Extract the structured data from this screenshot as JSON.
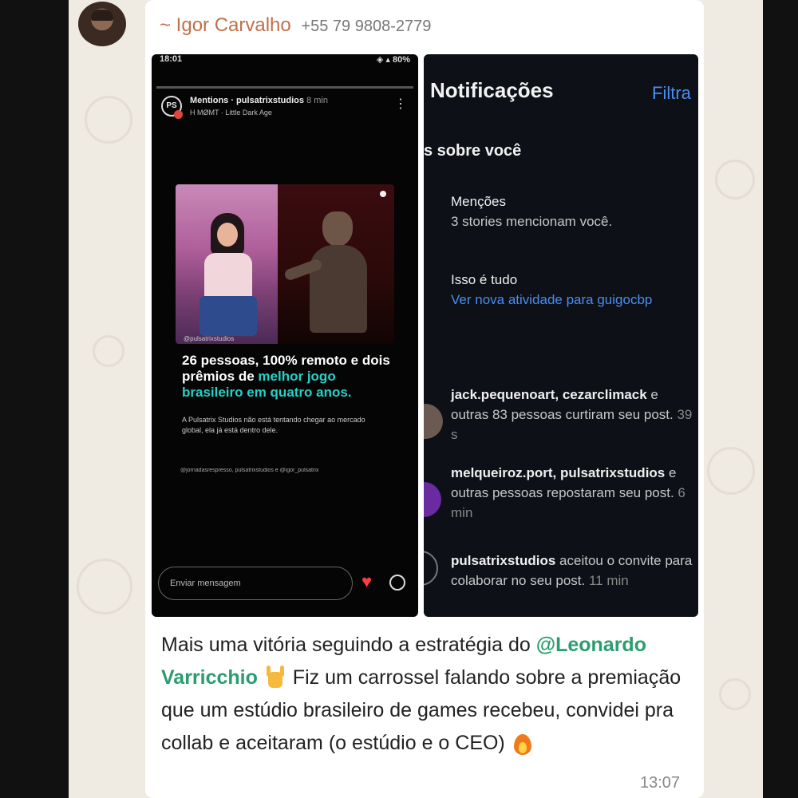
{
  "message": {
    "sender_name": "~ Igor Carvalho",
    "sender_phone": "+55 79 9808-2779",
    "time": "13:07",
    "text_before_mention": "Mais uma vitória seguindo a estratégia do ",
    "mention": "@Leonardo Varricchio",
    "text_after_mention": " Fiz um carrossel falando sobre a premiação que um estúdio brasileiro de games recebeu, convidei pra collab e aceitaram (o estúdio e o CEO)"
  },
  "story": {
    "status_time": "18:01",
    "status_icons": "◈ ▴ 80%",
    "logo": "PS",
    "title": "Mentions · pulsatrixstudios",
    "ago": "8 min",
    "music": "H MØMT · Little Dark Age",
    "photo_tag": "@pulsatrixstudios",
    "headline_plain": "26 pessoas, 100% remoto e dois prêmios de ",
    "headline_highlight": "melhor jogo brasileiro em quatro anos.",
    "subtext": "A Pulsatrix Studios não está tentando chegar ao mercado global, ela já está dentro dele.",
    "mentions_line": "@jornadasrespresso, pulsatrixstudios e @igor_pulsatrix",
    "input_placeholder": "Enviar mensagem",
    "colors": {
      "highlight": "#26d0c6",
      "heart": "#ff3b4a"
    }
  },
  "notifications": {
    "title": "Notificações",
    "filter": "Filtra",
    "section": "s sobre você",
    "items": [
      {
        "strong": "Menções",
        "text": "3 stories mencionam você.",
        "time": ""
      },
      {
        "strong": "Isso é tudo",
        "link": "Ver nova atividade para guigocbp"
      },
      {
        "strong": "jack.pequenoart, cezarclimack",
        "text": " e outras 83 pessoas curtiram seu post.",
        "time": " 39 s"
      },
      {
        "strong": "melqueiroz.port, pulsatrixstudios",
        "text": " e outras pessoas repostaram seu post.",
        "time": " 6 min"
      },
      {
        "strong": "pulsatrixstudios",
        "text": " aceitou o convite para colaborar no seu post.",
        "time": " 11 min"
      }
    ],
    "colors": {
      "link": "#4b8df0"
    }
  }
}
